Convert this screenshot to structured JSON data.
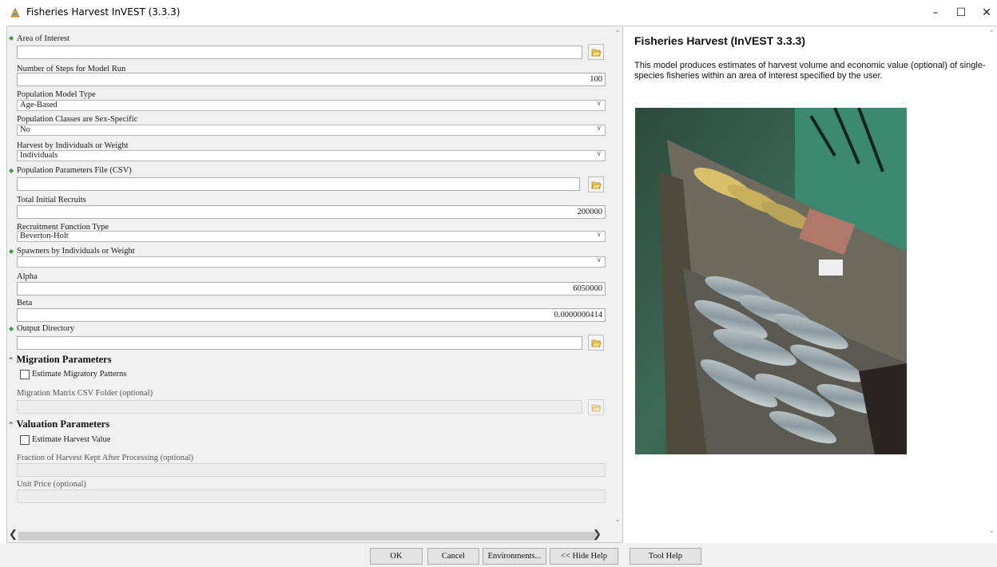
{
  "window": {
    "title": "Fisheries Harvest InVEST (3.3.3)",
    "minimize": "–",
    "maximize": "☐",
    "close": "✕"
  },
  "form": {
    "area_of_interest": {
      "label": "Area of Interest",
      "value": ""
    },
    "num_steps": {
      "label": "Number of Steps for Model Run",
      "value": "100"
    },
    "population_model_type": {
      "label": "Population Model Type",
      "value": "Age-Based"
    },
    "sex_specific": {
      "label": "Population Classes are Sex-Specific",
      "value": "No"
    },
    "harvest_by": {
      "label": "Harvest by Individuals or Weight",
      "value": "Individuals"
    },
    "population_params_file": {
      "label": "Population Parameters File (CSV)",
      "value": ""
    },
    "total_initial_recruits": {
      "label": "Total Initial Recruits",
      "value": "200000"
    },
    "recruitment_function": {
      "label": "Recruitment Function Type",
      "value": "Beverton-Holt"
    },
    "spawners_by": {
      "label": "Spawners by Individuals or Weight",
      "value": ""
    },
    "alpha": {
      "label": "Alpha",
      "value": "6050000"
    },
    "beta": {
      "label": "Beta",
      "value": "0.0000000414"
    },
    "output_directory": {
      "label": "Output Directory",
      "value": ""
    },
    "migration": {
      "section_label": "Migration Parameters",
      "checkbox_label": "Estimate Migratory Patterns",
      "checked": false,
      "folder_label": "Migration Matrix CSV Folder (optional)"
    },
    "valuation": {
      "section_label": "Valuation Parameters",
      "checkbox_label": "Estimate Harvest Value",
      "checked": false,
      "fraction_label": "Fraction of Harvest Kept After Processing (optional)",
      "unit_price_label": "Unit Price (optional)"
    }
  },
  "help": {
    "title": "Fisheries Harvest (InVEST 3.3.3)",
    "description": "This model produces estimates of harvest volume and economic value (optional) of single-species fisheries within an area of interest specified by the user."
  },
  "buttons": {
    "ok": "OK",
    "cancel": "Cancel",
    "environments": "Environments...",
    "hide_help": "<< Hide Help",
    "tool_help": "Tool Help"
  },
  "colors": {
    "required_marker": "#32a432",
    "pane_background": "#f0f0f0"
  }
}
